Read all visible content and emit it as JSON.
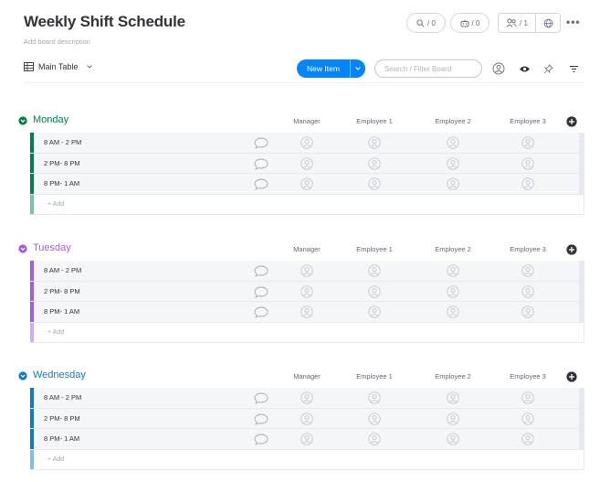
{
  "board": {
    "title": "Weekly Shift Schedule",
    "description": "Add board description"
  },
  "header": {
    "activity_count": "/ 0",
    "integrations_count": "/ 0",
    "members_count": "/ 1"
  },
  "toolbar": {
    "view_label": "Main Table",
    "new_item_label": "New Item",
    "search_placeholder": "Search / Filter Board"
  },
  "columns": [
    "Manager",
    "Employee 1",
    "Employee 2",
    "Employee 3"
  ],
  "groups": [
    {
      "name": "Monday",
      "color": "#037f4c",
      "light_color": "#8fc8a8",
      "rows": [
        "8 AM - 2 PM",
        "2 PM- 8 PM",
        "8 PM- 1 AM"
      ],
      "add_label": "+ Add"
    },
    {
      "name": "Tuesday",
      "color": "#a25ddc",
      "light_color": "#d4b6ee",
      "rows": [
        "8 AM - 2 PM",
        "2 PM- 8 PM",
        "8 PM- 1 AM"
      ],
      "add_label": "+ Add"
    },
    {
      "name": "Wednesday",
      "color": "#0f7bc2",
      "light_color": "#9ccbea",
      "rows": [
        "8 AM - 2 PM",
        "2 PM- 8 PM",
        "8 PM- 1 AM"
      ],
      "add_label": "+ Add"
    }
  ]
}
